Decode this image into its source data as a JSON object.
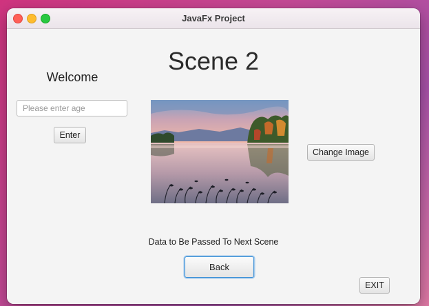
{
  "window": {
    "title": "JavaFx Project"
  },
  "scene": {
    "title": "Scene 2",
    "welcome_label": "Welcome",
    "age_input": {
      "placeholder": "Please enter age",
      "value": ""
    },
    "enter_button": "Enter",
    "change_image_button": "Change Image",
    "image": {
      "icon": "landscape-lake-photo"
    },
    "data_label": "Data to Be Passed To Next Scene",
    "back_button": "Back",
    "exit_button": "EXIT"
  },
  "colors": {
    "focus_ring": "#3b8fd6",
    "traffic_close": "#ff5f57",
    "traffic_minimize": "#febc2e",
    "traffic_maximize": "#28c840"
  }
}
